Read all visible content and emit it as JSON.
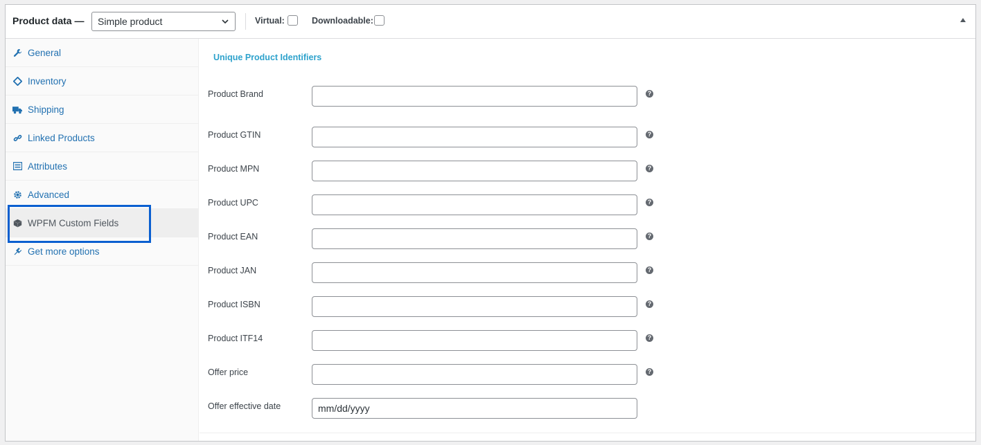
{
  "header": {
    "title": "Product data —",
    "product_type": "Simple product",
    "virtual_label": "Virtual:",
    "downloadable_label": "Downloadable:"
  },
  "sidebar": {
    "items": [
      {
        "label": "General",
        "icon": "wrench-icon"
      },
      {
        "label": "Inventory",
        "icon": "tag-icon"
      },
      {
        "label": "Shipping",
        "icon": "truck-icon"
      },
      {
        "label": "Linked Products",
        "icon": "link-icon"
      },
      {
        "label": "Attributes",
        "icon": "list-icon"
      },
      {
        "label": "Advanced",
        "icon": "gear-icon"
      },
      {
        "label": "WPFM Custom Fields",
        "icon": "cube-icon"
      },
      {
        "label": "Get more options",
        "icon": "plugin-icon"
      }
    ],
    "active_index": 6
  },
  "main": {
    "section_title": "Unique Product Identifiers",
    "fields": [
      {
        "label": "Product Brand",
        "value": "",
        "placeholder": ""
      },
      {
        "label": "Product GTIN",
        "value": "",
        "placeholder": ""
      },
      {
        "label": "Product MPN",
        "value": "",
        "placeholder": ""
      },
      {
        "label": "Product UPC",
        "value": "",
        "placeholder": ""
      },
      {
        "label": "Product EAN",
        "value": "",
        "placeholder": ""
      },
      {
        "label": "Product JAN",
        "value": "",
        "placeholder": ""
      },
      {
        "label": "Product ISBN",
        "value": "",
        "placeholder": ""
      },
      {
        "label": "Product ITF14",
        "value": "",
        "placeholder": ""
      },
      {
        "label": "Offer price",
        "value": "",
        "placeholder": ""
      },
      {
        "label": "Offer effective date",
        "value": "mm/dd/yyyy",
        "placeholder": "mm/dd/yyyy"
      }
    ],
    "help_glyph": "?"
  },
  "colors": {
    "link": "#2271b1",
    "section_title": "#2ea2cc",
    "highlight": "#0a5fd0"
  }
}
